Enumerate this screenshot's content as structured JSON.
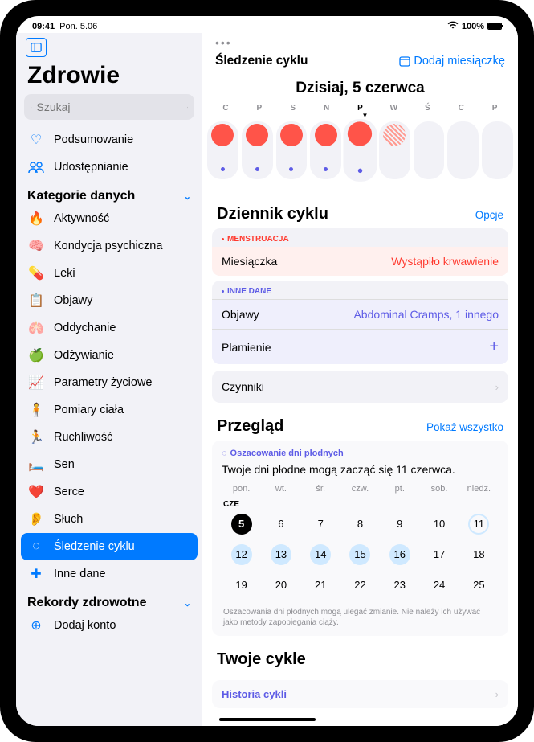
{
  "status": {
    "time": "09:41",
    "date": "Pon. 5.06",
    "battery": "100%"
  },
  "sidebar": {
    "appTitle": "Zdrowie",
    "searchPlaceholder": "Szukaj",
    "summary": "Podsumowanie",
    "sharing": "Udostępnianie",
    "catHeader": "Kategorie danych",
    "cats": {
      "activity": "Aktywność",
      "mental": "Kondycja psychiczna",
      "meds": "Leki",
      "symptoms": "Objawy",
      "resp": "Oddychanie",
      "nutrition": "Odżywianie",
      "vitals": "Parametry życiowe",
      "body": "Pomiary ciała",
      "mobility": "Ruchliwość",
      "sleep": "Sen",
      "heart": "Serce",
      "hearing": "Słuch",
      "cycle": "Śledzenie cyklu",
      "other": "Inne dane"
    },
    "recordsHeader": "Rekordy zdrowotne",
    "addAccount": "Dodaj konto"
  },
  "main": {
    "screenTitle": "Śledzenie cyklu",
    "addPeriod": "Dodaj miesiączkę",
    "todayHeader": "Dzisiaj, 5 czerwca",
    "dayLetters": [
      "C",
      "P",
      "S",
      "N",
      "P",
      "W",
      "Ś",
      "C",
      "P"
    ],
    "log": {
      "title": "Dziennik cyklu",
      "options": "Opcje",
      "menstruationLbl": "MENSTRUACJA",
      "periodRow": "Miesiączka",
      "periodVal": "Wystąpiło krwawienie",
      "otherLbl": "INNE DANE",
      "symptomsRow": "Objawy",
      "symptomsVal": "Abdominal Cramps, 1 innego",
      "spottingRow": "Plamienie",
      "factorsRow": "Czynniki"
    },
    "overview": {
      "title": "Przegląd",
      "showAll": "Pokaż wszystko",
      "fertileLabel": "Oszacowanie dni płodnych",
      "fertileText": "Twoje dni płodne mogą zacząć się 11 czerwca.",
      "dayHead": [
        "pon.",
        "wt.",
        "śr.",
        "czw.",
        "pt.",
        "sob.",
        "niedz."
      ],
      "month": "CZE",
      "week1": [
        "5",
        "6",
        "7",
        "8",
        "9",
        "10",
        "11"
      ],
      "week2": [
        "12",
        "13",
        "14",
        "15",
        "16",
        "17",
        "18"
      ],
      "week3": [
        "19",
        "20",
        "21",
        "22",
        "23",
        "24",
        "25"
      ],
      "disclaimer": "Oszacowania dni płodnych mogą ulegać zmianie. Nie należy ich używać jako metody zapobiegania ciąży."
    },
    "yourCycles": {
      "title": "Twoje cykle",
      "history": "Historia cykli"
    }
  }
}
